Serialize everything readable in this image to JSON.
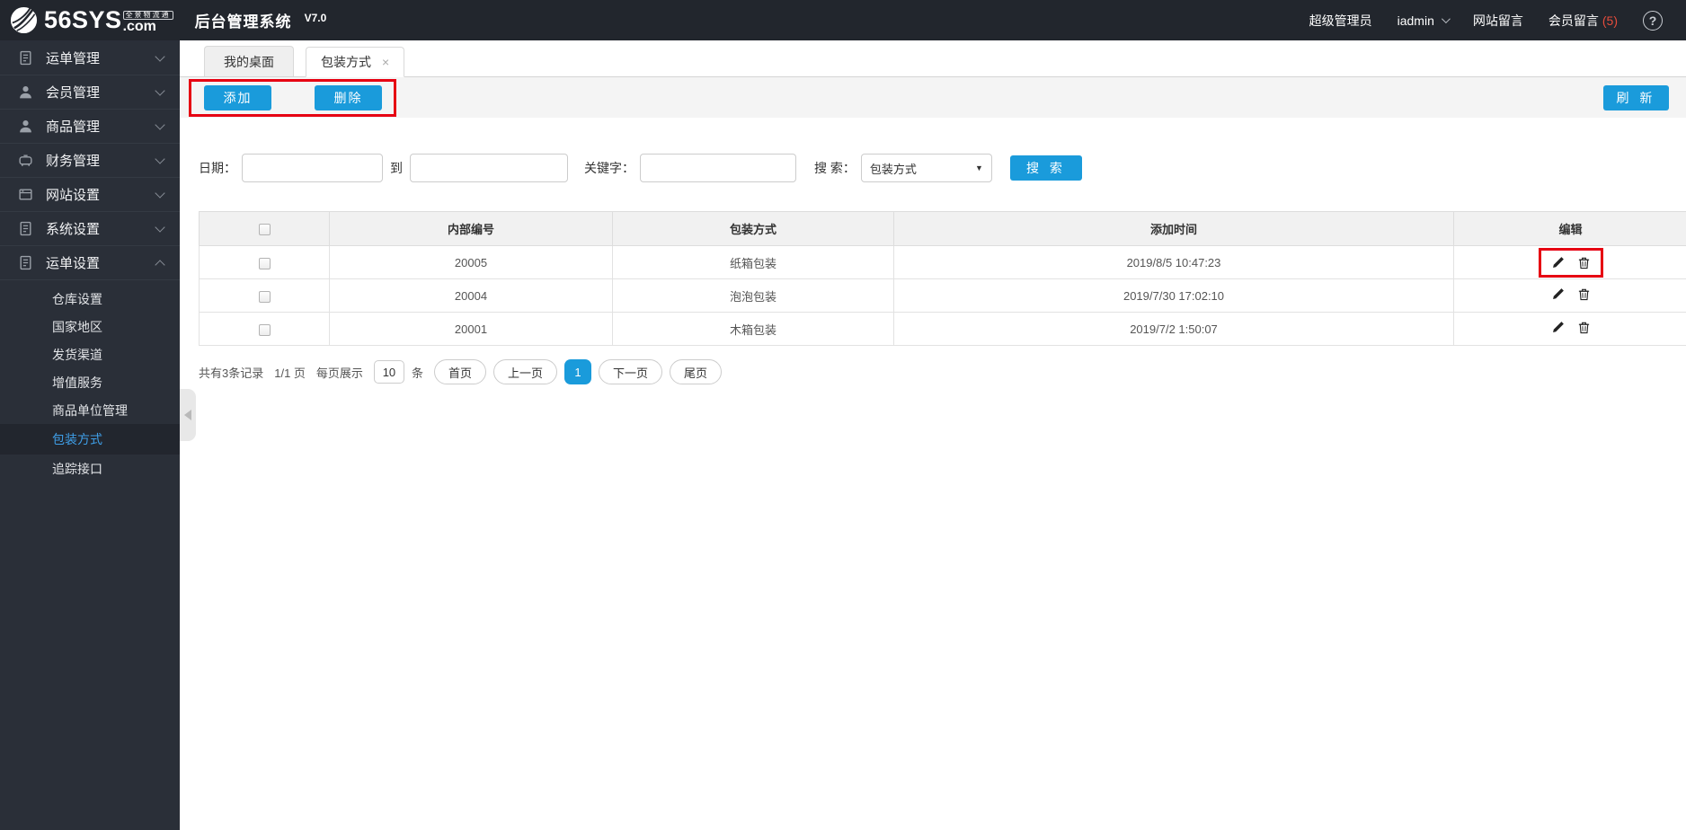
{
  "topbar": {
    "logo": {
      "main": "56SYS",
      "tagline": "全景物流通",
      "suffix": ".com"
    },
    "app_title": "后台管理系统",
    "version": "V7.0",
    "role": "超级管理员",
    "username": "iadmin",
    "nav_site_msg": "网站留言",
    "nav_member_msg": "会员留言",
    "member_msg_count": "(5)"
  },
  "sidebar": {
    "items": [
      {
        "label": "运单管理",
        "icon": "waybill-doc-icon"
      },
      {
        "label": "会员管理",
        "icon": "member-user-icon"
      },
      {
        "label": "商品管理",
        "icon": "goods-user-icon"
      },
      {
        "label": "财务管理",
        "icon": "finance-icon"
      },
      {
        "label": "网站设置",
        "icon": "website-window-icon"
      },
      {
        "label": "系统设置",
        "icon": "system-doc-icon"
      },
      {
        "label": "运单设置",
        "icon": "waybill-settings-icon",
        "expanded": true
      }
    ],
    "submenu": [
      {
        "label": "仓库设置"
      },
      {
        "label": "国家地区"
      },
      {
        "label": "发货渠道"
      },
      {
        "label": "增值服务"
      },
      {
        "label": "商品单位管理"
      },
      {
        "label": "包装方式",
        "active": true
      },
      {
        "label": "追踪接口"
      }
    ]
  },
  "tabs": [
    {
      "label": "我的桌面",
      "active": false
    },
    {
      "label": "包装方式",
      "active": true,
      "closable": true
    }
  ],
  "toolbar": {
    "add": "添加",
    "delete": "删除",
    "refresh": "刷 新"
  },
  "search": {
    "date_label": "日期：",
    "to_label": "到",
    "keyword_label": "关键字：",
    "search_by_label": "搜 索：",
    "select_value": "包装方式",
    "button": "搜 索"
  },
  "table": {
    "headers": [
      "内部编号",
      "包装方式",
      "添加时间",
      "编辑"
    ],
    "rows": [
      {
        "internal_no": "20005",
        "packing": "纸箱包装",
        "added": "2019/8/5 10:47:23"
      },
      {
        "internal_no": "20004",
        "packing": "泡泡包装",
        "added": "2019/7/30 17:02:10"
      },
      {
        "internal_no": "20001",
        "packing": "木箱包装",
        "added": "2019/7/2 1:50:07"
      }
    ]
  },
  "pagination": {
    "total": "共有3条记录",
    "page": "1/1 页",
    "per_page_label": "每页展示",
    "per_page_value": "10",
    "per_page_unit": "条",
    "first": "首页",
    "prev": "上一页",
    "current": "1",
    "next": "下一页",
    "last": "尾页"
  },
  "colors": {
    "accent_blue": "#1a9bdb",
    "annotation_red": "#e60012",
    "topbar_bg": "#22262d",
    "sidebar_bg": "#2a2f38",
    "active_link_blue": "#3f9fe8",
    "count_red": "#e74c3c"
  }
}
